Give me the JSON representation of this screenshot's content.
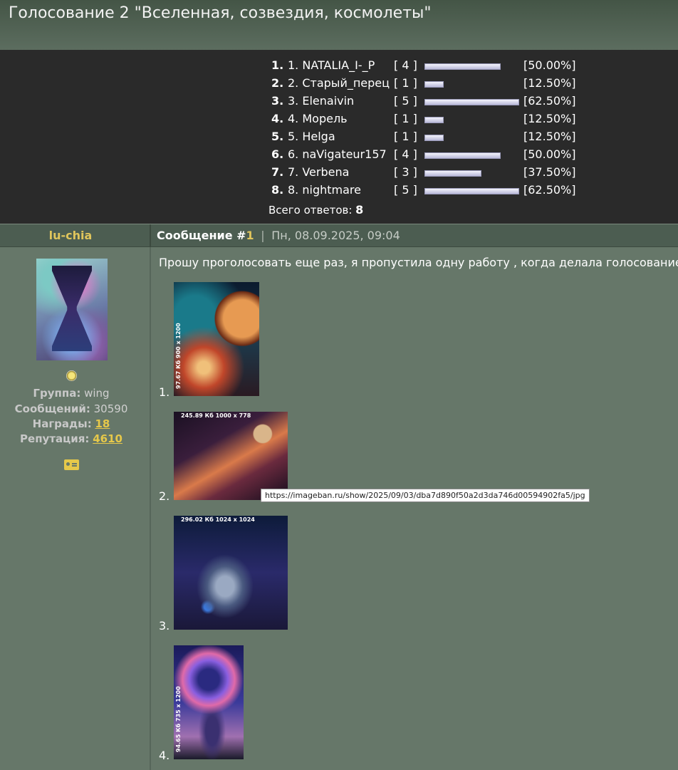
{
  "page": {
    "title": "Голосование 2 \"Вселенная, созвездия, космолеты\""
  },
  "poll": {
    "rows": [
      {
        "rank": "1.",
        "name": "1. NATALIA_I-_P",
        "votes": "[ 4 ]",
        "fraction": 0.5,
        "pct": "[50.00%]"
      },
      {
        "rank": "2.",
        "name": "2. Старый_перец",
        "votes": "[ 1 ]",
        "fraction": 0.125,
        "pct": "[12.50%]"
      },
      {
        "rank": "3.",
        "name": "3. Elenaivin",
        "votes": "[ 5 ]",
        "fraction": 0.625,
        "pct": "[62.50%]"
      },
      {
        "rank": "4.",
        "name": "4. Морель",
        "votes": "[ 1 ]",
        "fraction": 0.125,
        "pct": "[12.50%]"
      },
      {
        "rank": "5.",
        "name": "5. Helga",
        "votes": "[ 1 ]",
        "fraction": 0.125,
        "pct": "[12.50%]"
      },
      {
        "rank": "6.",
        "name": "6. naVigateur157",
        "votes": "[ 4 ]",
        "fraction": 0.5,
        "pct": "[50.00%]"
      },
      {
        "rank": "7.",
        "name": "7. Verbena",
        "votes": "[ 3 ]",
        "fraction": 0.375,
        "pct": "[37.50%]"
      },
      {
        "rank": "8.",
        "name": "8. nightmare",
        "votes": "[ 5 ]",
        "fraction": 0.625,
        "pct": "[62.50%]"
      }
    ],
    "total_label": "Всего ответов:",
    "total_value": "8"
  },
  "post": {
    "author": "lu-chia",
    "message_label": "Сообщение #",
    "message_number": "1",
    "separator": "|",
    "date": "Пн, 08.09.2025, 09:04",
    "text": "Прошу проголосовать еще раз, я пропустила одну работу , когда делала голосование"
  },
  "profile": {
    "group_label": "Группа:",
    "group_value": "wing",
    "messages_label": "Сообщений:",
    "messages_value": "30590",
    "awards_label": "Награды:",
    "awards_value": "18",
    "reputation_label": "Репутация:",
    "reputation_value": "4610"
  },
  "images": [
    {
      "num": "1.",
      "caption": "97.67 Кб 900 x 1200"
    },
    {
      "num": "2.",
      "caption": "245.89 Кб 1000 x 778"
    },
    {
      "num": "3.",
      "caption": "296.02 Кб 1024 x 1024"
    },
    {
      "num": "4.",
      "caption": "94.65 Кб 735 x 1200"
    }
  ],
  "tooltip": "https://imageban.ru/show/2025/09/03/dba7d890f50a2d3da746d00594902fa5/jpg",
  "icons": [
    "badge-icon",
    "profile-card-icon"
  ]
}
